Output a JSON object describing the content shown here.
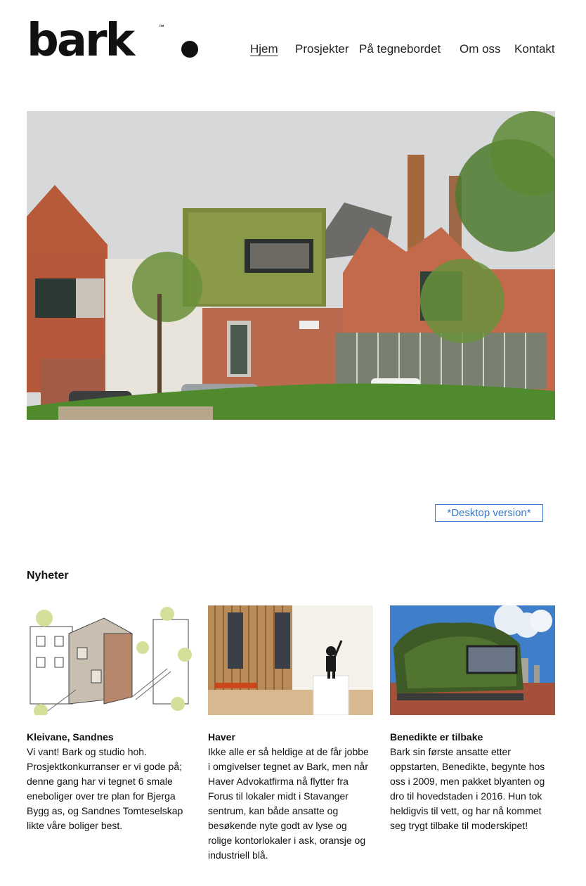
{
  "brand": {
    "name": "bark",
    "trademark": "™"
  },
  "nav": {
    "items": [
      {
        "label": "Hjem",
        "active": true
      },
      {
        "label": "Prosjekter",
        "active": false
      },
      {
        "label": "På tegnebordet",
        "active": false
      },
      {
        "label": "Om oss",
        "active": false
      },
      {
        "label": "Kontakt",
        "active": false
      }
    ]
  },
  "hero": {
    "image": "green-wall-brick-building-photo"
  },
  "desktop_button": {
    "label": "*Desktop version*"
  },
  "news": {
    "heading": "Nyheter",
    "items": [
      {
        "title": "Kleivane, Sandnes",
        "text": "Vi vant! Bark og studio hoh. Prosjektkonkurranser er vi gode på; denne gang har vi tegnet 6 smale eneboliger over tre plan for Bjerga Bygg as, og Sandnes Tomteselskap likte våre boliger best.",
        "image": "housing-sketch-illustration"
      },
      {
        "title": "Haver",
        "text": "Ikke alle er så heldige at de får jobbe i omgivelser tegnet av Bark, men når Haver Advokatfirma nå flytter fra Forus til lokaler midt i Stavanger sentrum, kan både ansatte og besøkende nyte godt av lyse og rolige kontorlokaler i ask, oransje og industriell blå.",
        "image": "office-interior-sculpture-photo"
      },
      {
        "title": "Benedikte er tilbake",
        "text": "Bark sin første ansatte etter oppstarten, Benedikte, begynte hos oss i 2009, men pakket blyanten og dro til hovedstaden i 2016. Hun tok heldigvis til vett, og har nå kommet seg trygt tilbake til moderskipet!",
        "image": "green-wall-sky-photo"
      }
    ]
  },
  "colors": {
    "accent": "#3a78c8",
    "text": "#111111",
    "background": "#ffffff"
  }
}
